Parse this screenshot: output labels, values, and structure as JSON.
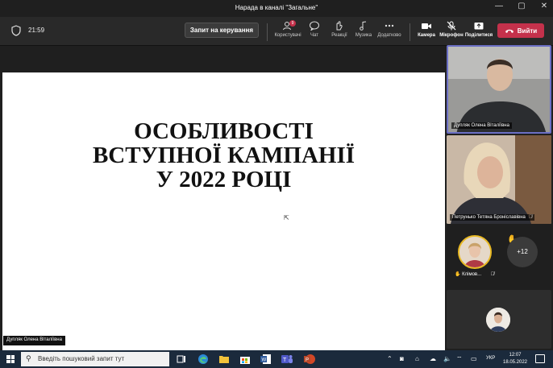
{
  "window": {
    "title": "Нарада в каналі \"Загальне\"",
    "controls": [
      "—",
      "▢",
      "✕"
    ]
  },
  "toolbar": {
    "time": "21:59",
    "request_control": "Запит на керування",
    "people_badge": "9",
    "tools": [
      {
        "label": "Користувачі",
        "icon": "people-icon"
      },
      {
        "label": "Чат",
        "icon": "chat-icon"
      },
      {
        "label": "Реакції",
        "icon": "reactions-icon"
      },
      {
        "label": "Музика",
        "icon": "music-icon"
      },
      {
        "label": "Додатково",
        "icon": "more-icon"
      }
    ],
    "camera": "Камера",
    "mic": "Мікрофон",
    "share": "Поділитися",
    "leave": "Вийти"
  },
  "slide": {
    "title": "ОСОБЛИВОСТІ\nВСТУПНОЇ КАМПАНІЇ\nУ 2022 РОЦІ"
  },
  "presenter": {
    "name": "Дупляк Олена Віталіївна"
  },
  "participants": {
    "tile1_name": "Дупляк Олена Віталіївна",
    "tile2_name": "Петрунько Тетяна Броніславівна",
    "short_name": "Клімов...",
    "more_count": "+12"
  },
  "taskbar": {
    "search_placeholder": "Введіть пошуковий запит тут",
    "language": "УКР",
    "time": "12:07",
    "date": "18.05.2022"
  },
  "colors": {
    "leave": "#c4314b",
    "active_speaker": "#6b6fc5",
    "raised_hand": "#e8b923"
  }
}
